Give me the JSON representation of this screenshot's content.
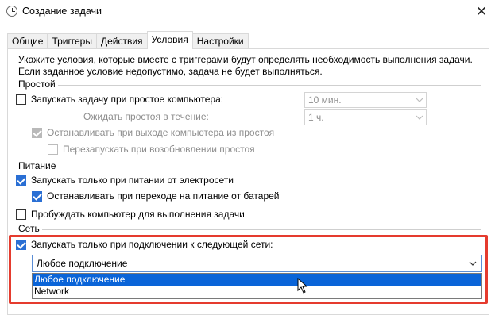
{
  "window": {
    "title": "Создание задачи"
  },
  "tabs": [
    {
      "label": "Общие",
      "active": false
    },
    {
      "label": "Триггеры",
      "active": false
    },
    {
      "label": "Действия",
      "active": false
    },
    {
      "label": "Условия",
      "active": true
    },
    {
      "label": "Настройки",
      "active": false
    }
  ],
  "intro": {
    "line1": "Укажите условия, которые вместе с триггерами будут определять необходимость выполнения задачи.",
    "line2": "Если заданное условие недопустимо, задача не будет выполняться."
  },
  "idle": {
    "group_label": "Простой",
    "start_on_idle": {
      "label": "Запускать задачу при простое компьютера:",
      "checked": false
    },
    "idle_for_value": "10 мин.",
    "wait_label": "Ожидать простоя в течение:",
    "wait_value": "1 ч.",
    "stop_on_resume": {
      "label": "Останавливать при выходе компьютера из простоя",
      "checked": true,
      "disabled": true
    },
    "restart_on_idle": {
      "label": "Перезапускать при возобновлении простоя",
      "checked": false,
      "disabled": true
    }
  },
  "power": {
    "group_label": "Питание",
    "ac_only": {
      "label": "Запускать только при питании от электросети",
      "checked": true
    },
    "stop_on_battery": {
      "label": "Останавливать при переходе на питание от батарей",
      "checked": true
    },
    "wake": {
      "label": "Пробуждать компьютер для выполнения задачи",
      "checked": false
    }
  },
  "network": {
    "group_label": "Сеть",
    "network_only": {
      "label": "Запускать только при подключении к следующей сети:",
      "checked": true
    },
    "selected_value": "Любое подключение",
    "options": [
      "Любое подключение",
      "Network"
    ],
    "highlighted_index": 0
  },
  "colors": {
    "accent": "#0a64d8",
    "checkbox": "#2a6fd4",
    "highlight_border": "#e53b2e"
  }
}
